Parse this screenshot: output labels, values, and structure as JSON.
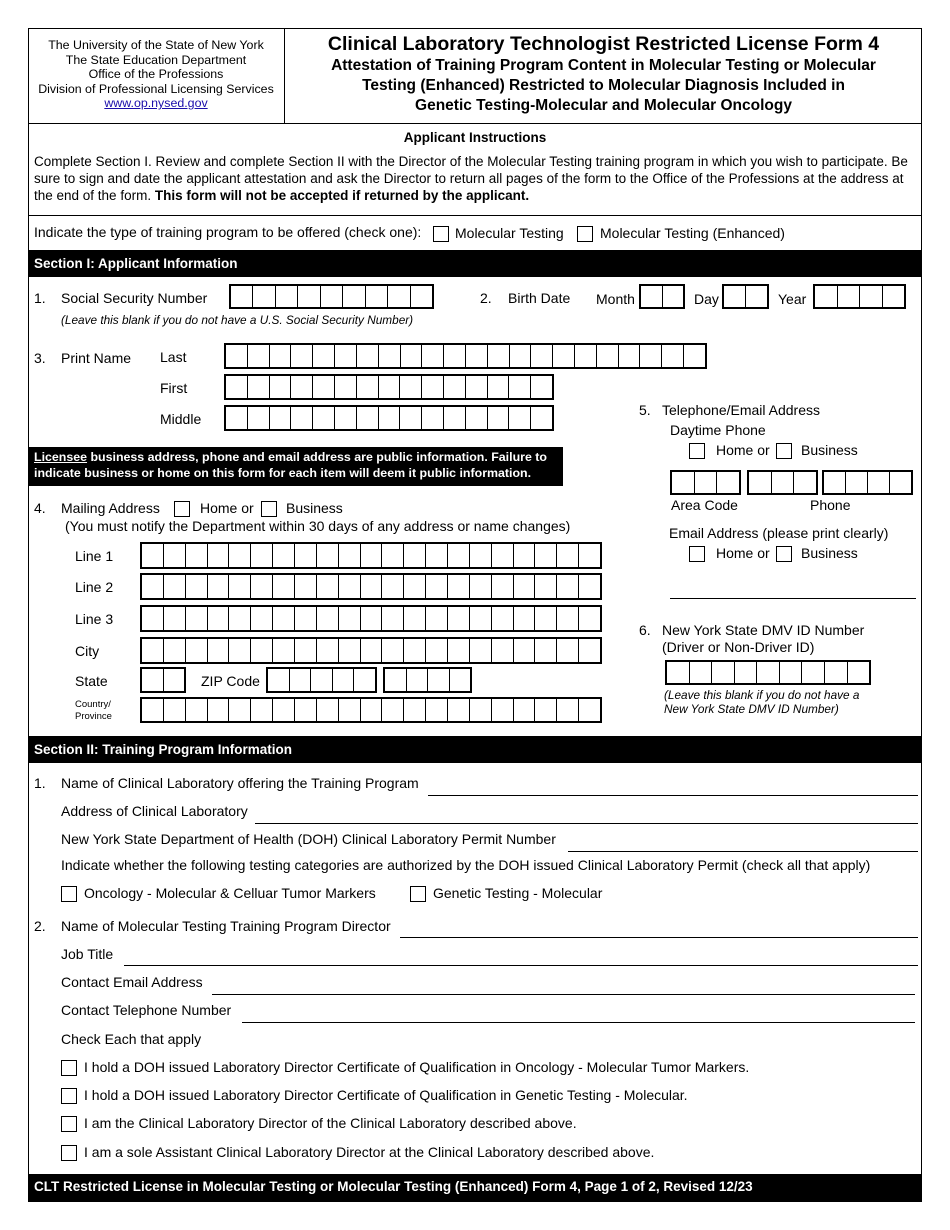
{
  "header": {
    "agency_lines": [
      "The University of the State of New York",
      "The State Education Department",
      "Office of the Professions",
      "Division of Professional Licensing Services"
    ],
    "website": "www.op.nysed.gov",
    "title": "Clinical Laboratory Technologist Restricted License Form 4",
    "subtitle_lines": [
      "Attestation of Training Program Content in Molecular Testing or Molecular",
      "Testing (Enhanced) Restricted to Molecular Diagnosis Included in",
      "Genetic Testing-Molecular and Molecular Oncology"
    ]
  },
  "instructions": {
    "title": "Applicant Instructions",
    "body": "Complete Section I. Review and complete Section II with the Director of the Molecular Testing training program in which you wish to participate. Be sure to sign and date the applicant attestation and ask the Director to return all pages of the form to the Office of the Professions at the address at the end of the form. ",
    "body_bold": "This form will not be accepted if returned by the applicant."
  },
  "program_type": {
    "prompt": "Indicate the type of training program to be offered (check one):",
    "options": [
      "Molecular Testing",
      "Molecular Testing (Enhanced)"
    ]
  },
  "section1": {
    "title": "Section I: Applicant Information",
    "ssn": {
      "num": "1.",
      "label": "Social Security Number",
      "note": "(Leave this blank if you do not have a U.S. Social Security Number)",
      "boxes": 9
    },
    "birth": {
      "num": "2.",
      "label": "Birth Date",
      "month": "Month",
      "day": "Day",
      "year": "Year"
    },
    "name": {
      "num": "3.",
      "label": "Print Name",
      "last": "Last",
      "first": "First",
      "middle": "Middle"
    },
    "notice_link": "Licensee",
    "notice_text": " business address, phone and email address are public information. Failure to indicate business or home on this form for each item will deem it public information.",
    "mailing": {
      "num": "4.",
      "label": "Mailing Address",
      "home": "Home or",
      "business": "Business",
      "note": "(You must notify the Department within 30 days of any address or name changes)",
      "line1": "Line 1",
      "line2": "Line 2",
      "line3": "Line 3",
      "city": "City",
      "state": "State",
      "zip": "ZIP Code",
      "country": "Country/",
      "province": "Province"
    },
    "phone": {
      "num": "5.",
      "label": "Telephone/Email Address",
      "daytime": "Daytime Phone",
      "home": "Home or",
      "business": "Business",
      "area_code": "Area Code",
      "phone": "Phone",
      "email": "Email Address (please print clearly)"
    },
    "dmv": {
      "num": "6.",
      "label": "New York State DMV ID Number",
      "sub": "(Driver or Non-Driver ID)",
      "note1": "(Leave this blank if you do not have a",
      "note2": "New York State DMV ID Number)"
    }
  },
  "section2": {
    "title": "Section II: Training Program Information",
    "q1": {
      "num": "1.",
      "lab_name": "Name of Clinical Laboratory offering the Training Program",
      "lab_address": "Address of Clinical Laboratory",
      "permit": "New York State Department of Health (DOH) Clinical Laboratory Permit Number",
      "categories_prompt": "Indicate whether the following testing categories are authorized by the DOH issued Clinical Laboratory Permit (check all that apply)",
      "categories": [
        "Oncology - Molecular & Celluar Tumor Markers",
        "Genetic Testing - Molecular"
      ]
    },
    "q2": {
      "num": "2.",
      "director_name": "Name of Molecular Testing Training Program Director",
      "job_title": "Job Title",
      "email": "Contact Email Address",
      "phone": "Contact Telephone Number",
      "check_prompt": "Check Each that apply",
      "checks": [
        "I hold a DOH issued Laboratory Director Certificate of Qualification in Oncology - Molecular Tumor Markers.",
        "I hold a DOH issued Laboratory Director Certificate of Qualification in Genetic Testing - Molecular.",
        "I am the Clinical Laboratory Director of the Clinical Laboratory described above.",
        "I am a sole Assistant Clinical Laboratory Director at the Clinical Laboratory described above."
      ]
    }
  },
  "footer": "CLT Restricted License in Molecular Testing or Molecular Testing (Enhanced) Form 4, Page 1 of 2, Revised 12/23"
}
